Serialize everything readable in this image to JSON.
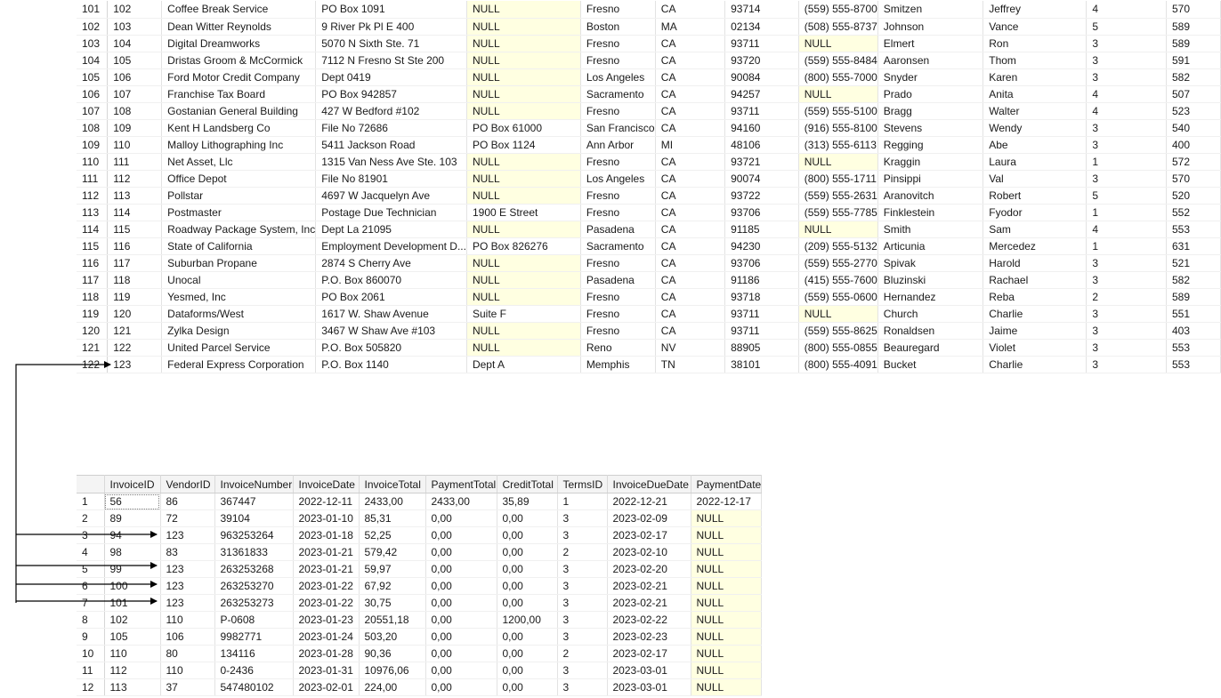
{
  "vendors": {
    "rows": [
      {
        "rn": "101",
        "c": [
          "102",
          "Coffee Break Service",
          "PO Box 1091",
          "NULL",
          "Fresno",
          "CA",
          "93714",
          "(559) 555-8700",
          "Smitzen",
          "Jeffrey",
          "4",
          "570"
        ]
      },
      {
        "rn": "102",
        "c": [
          "103",
          "Dean Witter Reynolds",
          "9 River Pk Pl E 400",
          "NULL",
          "Boston",
          "MA",
          "02134",
          "(508) 555-8737",
          "Johnson",
          "Vance",
          "5",
          "589"
        ]
      },
      {
        "rn": "103",
        "c": [
          "104",
          "Digital Dreamworks",
          "5070 N Sixth Ste. 71",
          "NULL",
          "Fresno",
          "CA",
          "93711",
          "NULL",
          "Elmert",
          "Ron",
          "3",
          "589"
        ]
      },
      {
        "rn": "104",
        "c": [
          "105",
          "Dristas Groom & McCormick",
          "7112 N Fresno St Ste 200",
          "NULL",
          "Fresno",
          "CA",
          "93720",
          "(559) 555-8484",
          "Aaronsen",
          "Thom",
          "3",
          "591"
        ]
      },
      {
        "rn": "105",
        "c": [
          "106",
          "Ford Motor Credit Company",
          "Dept 0419",
          "NULL",
          "Los Angeles",
          "CA",
          "90084",
          "(800) 555-7000",
          "Snyder",
          "Karen",
          "3",
          "582"
        ]
      },
      {
        "rn": "106",
        "c": [
          "107",
          "Franchise Tax Board",
          "PO Box 942857",
          "NULL",
          "Sacramento",
          "CA",
          "94257",
          "NULL",
          "Prado",
          "Anita",
          "4",
          "507"
        ]
      },
      {
        "rn": "107",
        "c": [
          "108",
          "Gostanian General Building",
          "427 W Bedford #102",
          "NULL",
          "Fresno",
          "CA",
          "93711",
          "(559) 555-5100",
          "Bragg",
          "Walter",
          "4",
          "523"
        ]
      },
      {
        "rn": "108",
        "c": [
          "109",
          "Kent H Landsberg Co",
          "File No 72686",
          "PO Box 61000",
          "San Francisco",
          "CA",
          "94160",
          "(916) 555-8100",
          "Stevens",
          "Wendy",
          "3",
          "540"
        ]
      },
      {
        "rn": "109",
        "c": [
          "110",
          "Malloy Lithographing Inc",
          "5411 Jackson Road",
          "PO Box 1124",
          "Ann Arbor",
          "MI",
          "48106",
          "(313) 555-6113",
          "Regging",
          "Abe",
          "3",
          "400"
        ]
      },
      {
        "rn": "110",
        "c": [
          "111",
          "Net Asset, Llc",
          "1315 Van Ness Ave Ste. 103",
          "NULL",
          "Fresno",
          "CA",
          "93721",
          "NULL",
          "Kraggin",
          "Laura",
          "1",
          "572"
        ]
      },
      {
        "rn": "111",
        "c": [
          "112",
          "Office Depot",
          "File No 81901",
          "NULL",
          "Los Angeles",
          "CA",
          "90074",
          "(800) 555-1711",
          "Pinsippi",
          "Val",
          "3",
          "570"
        ]
      },
      {
        "rn": "112",
        "c": [
          "113",
          "Pollstar",
          "4697 W Jacquelyn Ave",
          "NULL",
          "Fresno",
          "CA",
          "93722",
          "(559) 555-2631",
          "Aranovitch",
          "Robert",
          "5",
          "520"
        ]
      },
      {
        "rn": "113",
        "c": [
          "114",
          "Postmaster",
          "Postage Due Technician",
          "1900 E Street",
          "Fresno",
          "CA",
          "93706",
          "(559) 555-7785",
          "Finklestein",
          "Fyodor",
          "1",
          "552"
        ]
      },
      {
        "rn": "114",
        "c": [
          "115",
          "Roadway Package System, Inc",
          "Dept La 21095",
          "NULL",
          "Pasadena",
          "CA",
          "91185",
          "NULL",
          "Smith",
          "Sam",
          "4",
          "553"
        ]
      },
      {
        "rn": "115",
        "c": [
          "116",
          "State of California",
          "Employment Development D...",
          "PO Box 826276",
          "Sacramento",
          "CA",
          "94230",
          "(209) 555-5132",
          "Articunia",
          "Mercedez",
          "1",
          "631"
        ]
      },
      {
        "rn": "116",
        "c": [
          "117",
          "Suburban Propane",
          "2874 S Cherry Ave",
          "NULL",
          "Fresno",
          "CA",
          "93706",
          "(559) 555-2770",
          "Spivak",
          "Harold",
          "3",
          "521"
        ]
      },
      {
        "rn": "117",
        "c": [
          "118",
          "Unocal",
          "P.O. Box 860070",
          "NULL",
          "Pasadena",
          "CA",
          "91186",
          "(415) 555-7600",
          "Bluzinski",
          "Rachael",
          "3",
          "582"
        ]
      },
      {
        "rn": "118",
        "c": [
          "119",
          "Yesmed, Inc",
          "PO Box 2061",
          "NULL",
          "Fresno",
          "CA",
          "93718",
          "(559) 555-0600",
          "Hernandez",
          "Reba",
          "2",
          "589"
        ]
      },
      {
        "rn": "119",
        "c": [
          "120",
          "Dataforms/West",
          "1617 W. Shaw Avenue",
          "Suite F",
          "Fresno",
          "CA",
          "93711",
          "NULL",
          "Church",
          "Charlie",
          "3",
          "551"
        ]
      },
      {
        "rn": "120",
        "c": [
          "121",
          "Zylka Design",
          "3467 W Shaw Ave #103",
          "NULL",
          "Fresno",
          "CA",
          "93711",
          "(559) 555-8625",
          "Ronaldsen",
          "Jaime",
          "3",
          "403"
        ]
      },
      {
        "rn": "121",
        "c": [
          "122",
          "United Parcel Service",
          "P.O. Box 505820",
          "NULL",
          "Reno",
          "NV",
          "88905",
          "(800) 555-0855",
          "Beauregard",
          "Violet",
          "3",
          "553"
        ]
      },
      {
        "rn": "122",
        "c": [
          "123",
          "Federal Express Corporation",
          "P.O. Box 1140",
          "Dept A",
          "Memphis",
          "TN",
          "38101",
          "(800) 555-4091",
          "Bucket",
          "Charlie",
          "3",
          "553"
        ]
      }
    ]
  },
  "invoices": {
    "columns": [
      "InvoiceID",
      "VendorID",
      "InvoiceNumber",
      "InvoiceDate",
      "InvoiceTotal",
      "PaymentTotal",
      "CreditTotal",
      "TermsID",
      "InvoiceDueDate",
      "PaymentDate"
    ],
    "rows": [
      {
        "rn": "1",
        "c": [
          "56",
          "86",
          "367447",
          "2022-12-11",
          "2433,00",
          "2433,00",
          "35,89",
          "1",
          "2022-12-21",
          "2022-12-17"
        ]
      },
      {
        "rn": "2",
        "c": [
          "89",
          "72",
          "39104",
          "2023-01-10",
          "85,31",
          "0,00",
          "0,00",
          "3",
          "2023-02-09",
          "NULL"
        ]
      },
      {
        "rn": "3",
        "c": [
          "94",
          "123",
          "963253264",
          "2023-01-18",
          "52,25",
          "0,00",
          "0,00",
          "3",
          "2023-02-17",
          "NULL"
        ]
      },
      {
        "rn": "4",
        "c": [
          "98",
          "83",
          "31361833",
          "2023-01-21",
          "579,42",
          "0,00",
          "0,00",
          "2",
          "2023-02-10",
          "NULL"
        ]
      },
      {
        "rn": "5",
        "c": [
          "99",
          "123",
          "263253268",
          "2023-01-21",
          "59,97",
          "0,00",
          "0,00",
          "3",
          "2023-02-20",
          "NULL"
        ]
      },
      {
        "rn": "6",
        "c": [
          "100",
          "123",
          "263253270",
          "2023-01-22",
          "67,92",
          "0,00",
          "0,00",
          "3",
          "2023-02-21",
          "NULL"
        ]
      },
      {
        "rn": "7",
        "c": [
          "101",
          "123",
          "263253273",
          "2023-01-22",
          "30,75",
          "0,00",
          "0,00",
          "3",
          "2023-02-21",
          "NULL"
        ]
      },
      {
        "rn": "8",
        "c": [
          "102",
          "110",
          "P-0608",
          "2023-01-23",
          "20551,18",
          "0,00",
          "1200,00",
          "3",
          "2023-02-22",
          "NULL"
        ]
      },
      {
        "rn": "9",
        "c": [
          "105",
          "106",
          "9982771",
          "2023-01-24",
          "503,20",
          "0,00",
          "0,00",
          "3",
          "2023-02-23",
          "NULL"
        ]
      },
      {
        "rn": "10",
        "c": [
          "110",
          "80",
          "134116",
          "2023-01-28",
          "90,36",
          "0,00",
          "0,00",
          "2",
          "2023-02-17",
          "NULL"
        ]
      },
      {
        "rn": "11",
        "c": [
          "112",
          "110",
          "0-2436",
          "2023-01-31",
          "10976,06",
          "0,00",
          "0,00",
          "3",
          "2023-03-01",
          "NULL"
        ]
      },
      {
        "rn": "12",
        "c": [
          "113",
          "37",
          "547480102",
          "2023-02-01",
          "224,00",
          "0,00",
          "0,00",
          "3",
          "2023-03-01",
          "NULL"
        ]
      }
    ]
  },
  "colors": {
    "null_highlight": "#ffffe1",
    "arrow": "#000000"
  }
}
